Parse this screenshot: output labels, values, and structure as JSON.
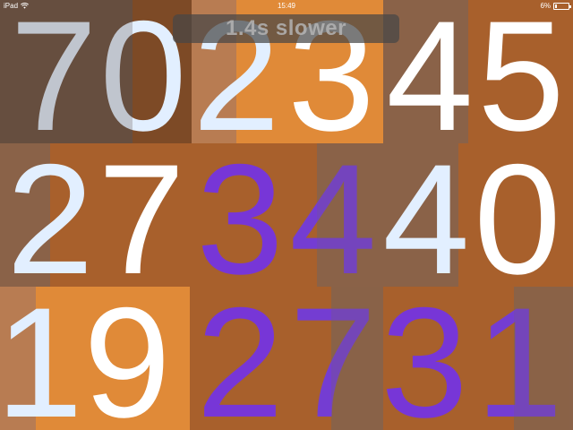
{
  "status_bar": {
    "device": "iPad",
    "time": "15:49",
    "battery": "6%"
  },
  "banner": {
    "text": "1.4s slower"
  },
  "board": {
    "rows": [
      [
        "7",
        "0",
        "2",
        "3",
        "4",
        "5"
      ],
      [
        "2",
        "7",
        "3",
        "4",
        "4",
        "0"
      ],
      [
        "1",
        "9",
        "2",
        "7",
        "3",
        "1"
      ]
    ]
  },
  "colors": {
    "orange": "#e08a38",
    "brown_dark": "#6a5040",
    "brown_mid": "#8a6248",
    "rust": "#a8602c",
    "tan": "#b87c52",
    "purple": "#7333e6",
    "white": "#ffffff"
  }
}
